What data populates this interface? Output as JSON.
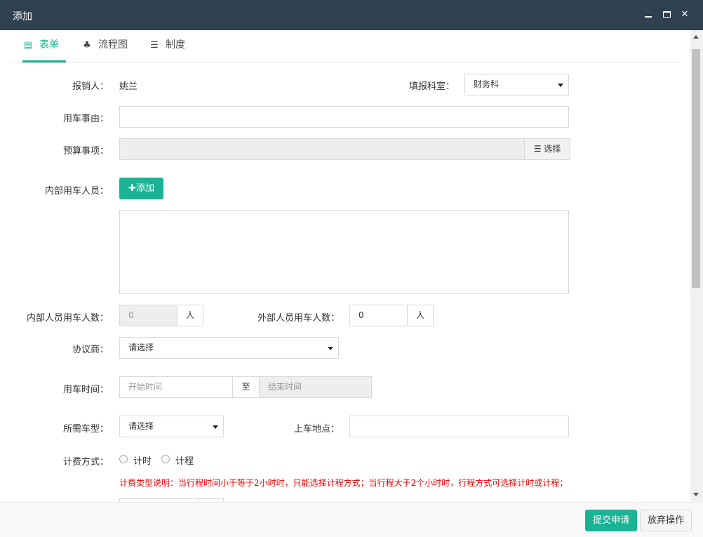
{
  "window": {
    "title": "添加"
  },
  "tabs": [
    {
      "label": "表单",
      "icon": "form-icon"
    },
    {
      "label": "流程图",
      "icon": "sitemap-icon"
    },
    {
      "label": "制度",
      "icon": "list-icon"
    }
  ],
  "form": {
    "reporter_label": "报销人：",
    "reporter_value": "姚兰",
    "dept_label": "填报科室：",
    "dept_value": "财务科",
    "reason_label": "用车事由：",
    "budget_label": "预算事项：",
    "budget_button": "选择",
    "internal_staff_label": "内部用车人员：",
    "add_button": "添加",
    "internal_count_label": "内部人员用车人数：",
    "internal_count_value": "0",
    "person_unit": "人",
    "external_count_label": "外部人员用车人数：",
    "external_count_value": "0",
    "vendor_label": "协议商：",
    "vendor_value": "请选择",
    "time_label": "用车时间：",
    "start_placeholder": "开始时间",
    "to_text": "至",
    "end_placeholder": "结束时间",
    "car_type_label": "所需车型：",
    "car_type_value": "请选择",
    "pickup_label": "上车地点：",
    "billing_label": "计费方式：",
    "billing_options": [
      "计时",
      "计程"
    ],
    "billing_note": "计费类型说明：当行程时间小于等于2小时时，只能选择计程方式；当行程大于2个小时时，行程方式可选择计时或计程；"
  },
  "footer": {
    "submit": "提交申请",
    "cancel": "放弃操作"
  },
  "colors": {
    "accent": "#1ab394",
    "titlebar": "#2f4050",
    "warning": "#ee0000"
  }
}
